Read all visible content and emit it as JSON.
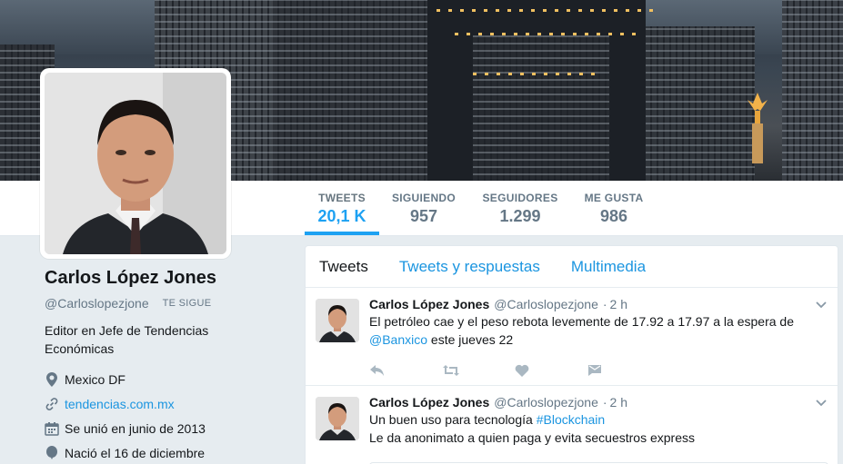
{
  "profile": {
    "name": "Carlos López Jones",
    "handle": "@Carloslopezjone",
    "follows_badge": "TE SIGUE",
    "bio": "Editor en Jefe de Tendencias Económicas",
    "location": "Mexico DF",
    "website": "tendencias.com.mx",
    "joined": "Se unió en junio de 2013",
    "birthday": "Nació el 16 de diciembre"
  },
  "stats": [
    {
      "label": "TWEETS",
      "value": "20,1 K"
    },
    {
      "label": "SIGUIENDO",
      "value": "957"
    },
    {
      "label": "SEGUIDORES",
      "value": "1.299"
    },
    {
      "label": "ME GUSTA",
      "value": "986"
    }
  ],
  "timeline_tabs": [
    "Tweets",
    "Tweets y respuestas",
    "Multimedia"
  ],
  "tweets": [
    {
      "name": "Carlos López Jones",
      "handle": "@Carloslopezjone",
      "sep": "·",
      "time": "2 h",
      "text_before": "El petróleo cae y el peso rebota levemente de 17.92 a 17.97 a la espera de",
      "mention": "@Banxico",
      "text_after": " este jueves 22"
    },
    {
      "name": "Carlos López Jones",
      "handle": "@Carloslopezjone",
      "sep": "·",
      "time": "2 h",
      "line1_before": "Un buen uso para tecnología ",
      "hashtag": "#Blockchain",
      "line2": "Le da anonimato a quien paga y evita secuestros express"
    }
  ],
  "colors": {
    "accent": "#1da1f2",
    "link": "#1b95e0",
    "muted": "#657786",
    "background": "#e6ecf0"
  }
}
